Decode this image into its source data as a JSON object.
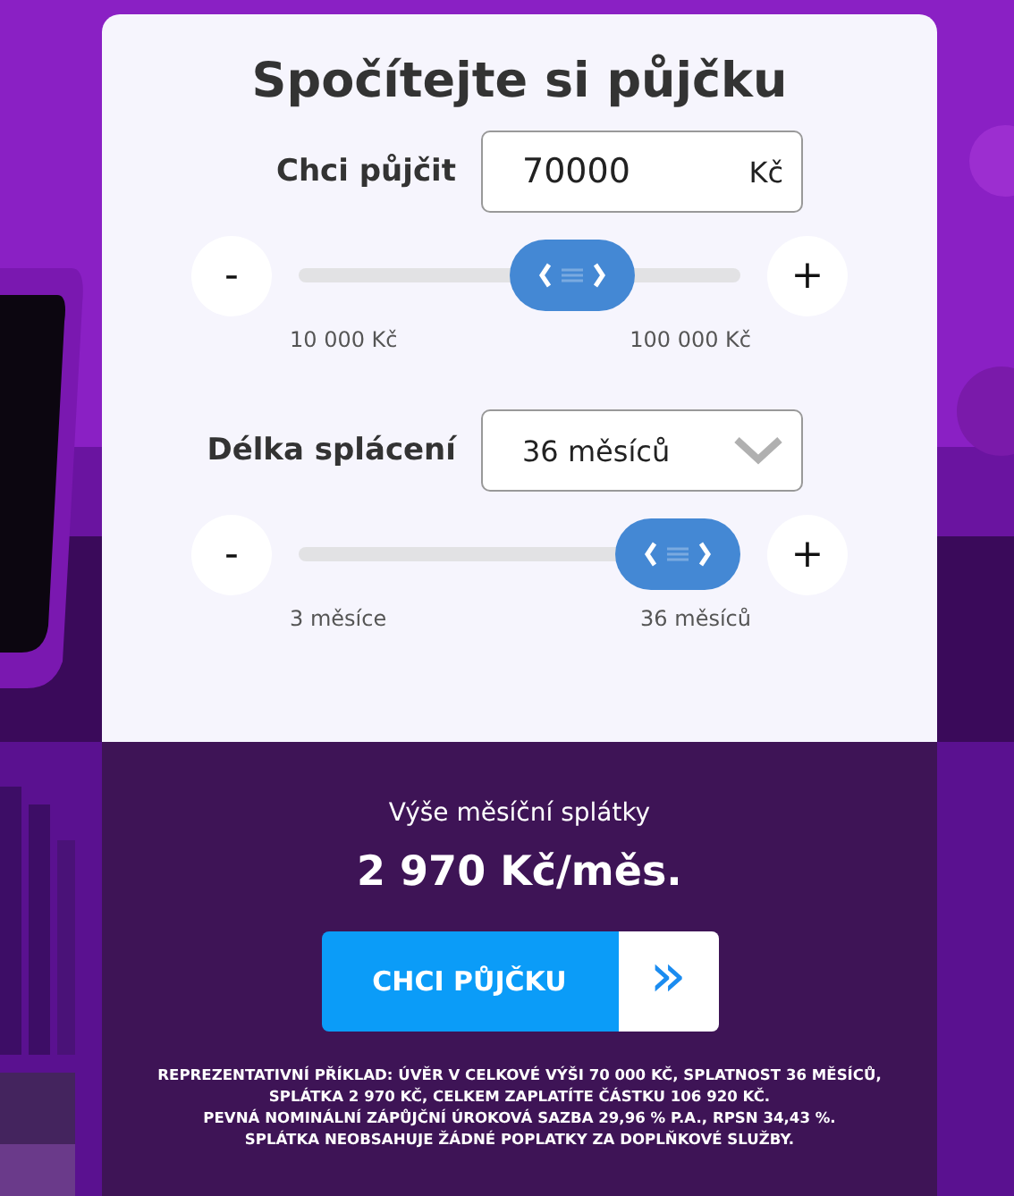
{
  "calculator": {
    "title": "Spočítejte si půjčku",
    "amount": {
      "label": "Chci půjčit",
      "value": "70000",
      "unit": "Kč",
      "minus": "-",
      "plus": "+",
      "level": 0.667,
      "min_label": "10 000 Kč",
      "max_label": "100 000 Kč"
    },
    "term": {
      "label": "Délka splácení",
      "value": "36 měsíců",
      "minus": "-",
      "plus": "+",
      "level": 1,
      "min_label": "3 měsíce",
      "max_label": "36 měsíců"
    }
  },
  "result": {
    "label": "Výše měsíční splátky",
    "value": "2 970 Kč/měs.",
    "button": "CHCI PŮJČKU",
    "button_arrow": "»",
    "disclaimer": [
      "REPREZENTATIVNÍ PŘÍKLAD: ÚVĚR V CELKOVÉ VÝŠI 70 000 KČ, SPLATNOST 36 MĚSÍCŮ,",
      "SPLÁTKA 2 970 KČ, CELKEM ZAPLATÍTE ČÁSTKU 106 920 KČ.",
      "PEVNÁ NOMINÁLNÍ ZÁPŮJČNÍ ÚROKOVÁ SAZBA 29,96 % P.A., RPSN 34,43 %.",
      "SPLÁTKA NEOBSAHUJE ŽÁDNÉ POPLATKY ZA DOPLŇKOVÉ SLUŽBY."
    ]
  }
}
